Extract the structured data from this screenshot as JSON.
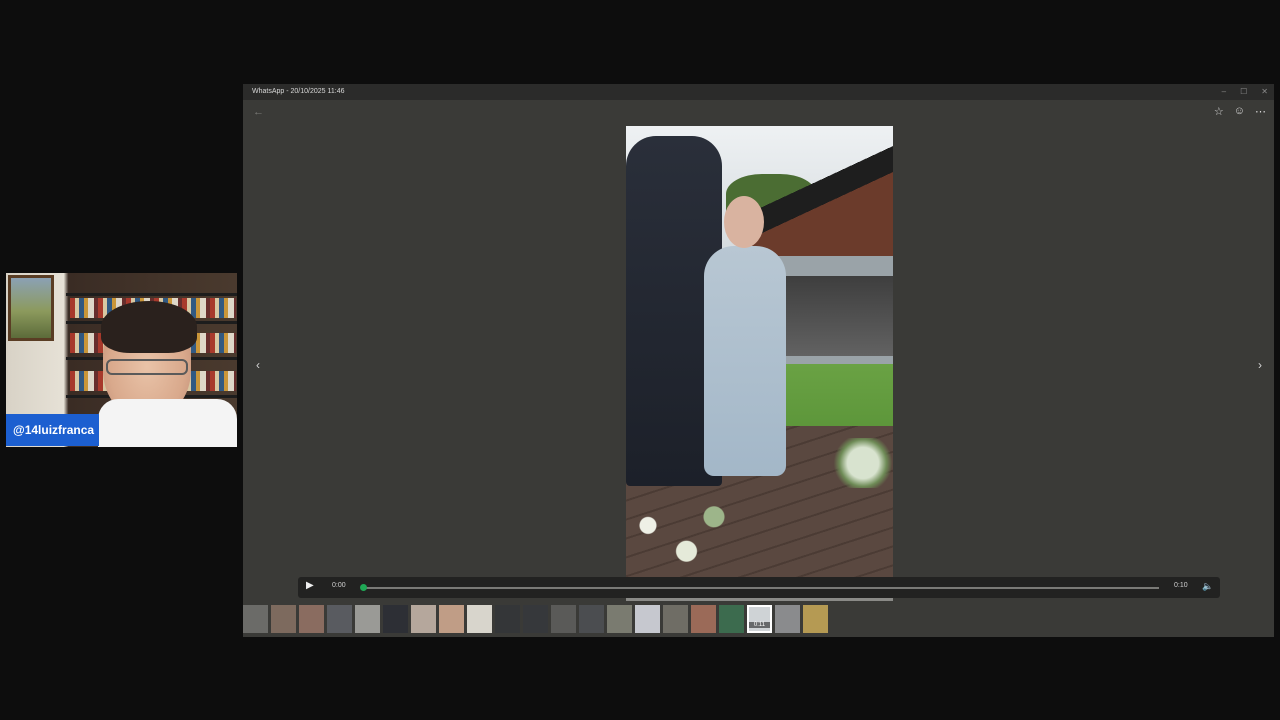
{
  "webcam": {
    "handle": "@14luizfranca"
  },
  "window": {
    "title": "WhatsApp - 20/10/2025 11:46",
    "controls": [
      "–",
      "☐",
      "✕"
    ]
  },
  "toolbar": {
    "back_icon": "arrow-left-icon",
    "back_label": "←",
    "actions": [
      {
        "name": "star-icon",
        "glyph": "☆"
      },
      {
        "name": "emoji-icon",
        "glyph": "☺"
      },
      {
        "name": "more-icon",
        "glyph": "⋯"
      }
    ]
  },
  "navigation": {
    "prev": "‹",
    "next": "›"
  },
  "player": {
    "play_glyph": "▶",
    "current_time": "0:00",
    "duration": "0:10",
    "volume_glyph": "🔈",
    "progress": 0.0
  },
  "thumbnails": {
    "count": 21,
    "selected_index": 18,
    "selected_label": "0:11",
    "colors": [
      "#6b6b68",
      "#7d6a5e",
      "#8a6c60",
      "#595b60",
      "#9a9a96",
      "#2d2f35",
      "#b5a79c",
      "#c09d86",
      "#d8d5cc",
      "#343638",
      "#36383b",
      "#5a5a58",
      "#4b4d50",
      "#7a7b70",
      "#c6c8cf",
      "#6f6d65",
      "#9b6a58",
      "#3c6b4e",
      "#cfd3d6",
      "#8a8b8d",
      "#b59a53"
    ]
  }
}
